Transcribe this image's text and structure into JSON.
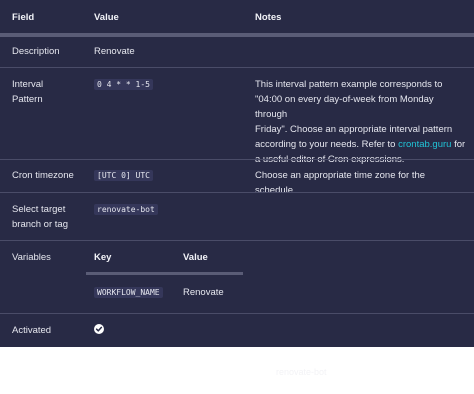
{
  "table": {
    "headers": {
      "field": "Field",
      "value": "Value",
      "notes": "Notes"
    },
    "rows": {
      "description": {
        "field": "Description",
        "value": "Renovate"
      },
      "interval": {
        "field_line1": "Interval",
        "field_line2": "Pattern",
        "value": "0 4 * * 1-5",
        "notes_line1": "This interval pattern example corresponds to",
        "notes_line2": "\"04:00 on every day-of-week from Monday through",
        "notes_line3": "Friday\". Choose an appropriate interval pattern",
        "notes_line4_prefix": "according to your needs. Refer to ",
        "notes_link": "crontab.guru",
        "notes_line4_suffix": " for",
        "notes_line5": "a useful editor of Cron expressions."
      },
      "cron_timezone": {
        "field": "Cron timezone",
        "value": "[UTC 0] UTC",
        "notes": "Choose an appropriate time zone for the schedule."
      },
      "target_branch": {
        "field_line1": "Select target",
        "field_line2": "branch or tag",
        "value": "renovate-bot"
      },
      "variables": {
        "field": "Variables",
        "headers": {
          "key": "Key",
          "value": "Value"
        },
        "items": [
          {
            "key": "WORKFLOW_NAME",
            "value": "Renovate"
          }
        ]
      },
      "activated": {
        "field": "Activated",
        "icon": "check-circle-icon"
      }
    }
  },
  "footer_faint_text": "renovate-bot"
}
